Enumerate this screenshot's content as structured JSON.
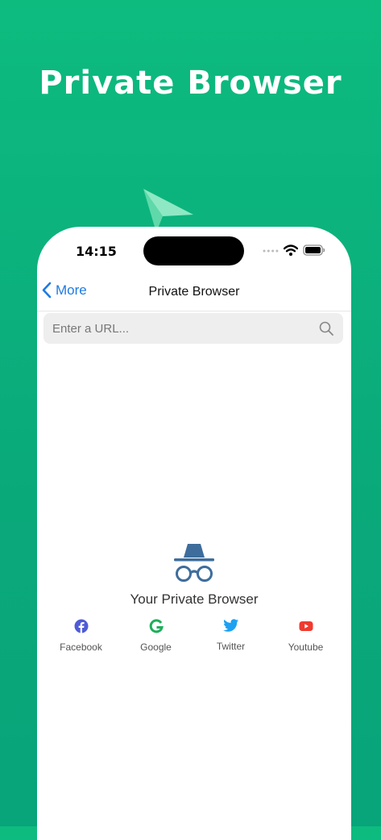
{
  "hero": {
    "title": "Private Browser"
  },
  "status_bar": {
    "time": "14:15"
  },
  "nav": {
    "back_label": "More",
    "title": "Private Browser"
  },
  "search": {
    "placeholder": "Enter a URL...",
    "value": ""
  },
  "main": {
    "label": "Your Private Browser"
  },
  "shortcuts": [
    {
      "label": "Facebook",
      "icon": "facebook-icon",
      "color": "#4f5bd5"
    },
    {
      "label": "Google",
      "icon": "google-icon",
      "color": "#1fae5b"
    },
    {
      "label": "Twitter",
      "icon": "twitter-icon",
      "color": "#1da1f2"
    },
    {
      "label": "Youtube",
      "icon": "youtube-icon",
      "color": "#f03a2e"
    }
  ],
  "colors": {
    "background": "#0aae7b",
    "accent": "#1d7be2",
    "incognito_icon": "#3e6d9c"
  }
}
